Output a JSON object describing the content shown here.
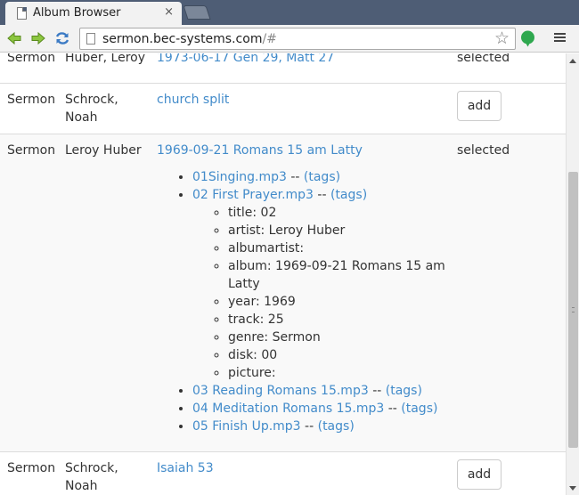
{
  "browser": {
    "tab_title": "Album Browser",
    "close_glyph": "×",
    "url_host": "sermon.bec-systems.com",
    "url_path": "/#",
    "star_glyph": "☆"
  },
  "rows": [
    {
      "type": "Sermon",
      "artist": "Huber, Leroy",
      "album": "1973-06-17 Gen 29, Matt 27",
      "status": "selected"
    },
    {
      "type": "Sermon",
      "artist": "Schrock, Noah",
      "album": "church split",
      "action": "add"
    },
    {
      "type": "Sermon",
      "artist": "Leroy Huber",
      "album": "1969-09-21 Romans 15 am Latty",
      "status": "selected",
      "tracks": [
        {
          "name": "01Singing.mp3",
          "sep": " -- ",
          "tags_link": "(tags)"
        },
        {
          "name": "02 First Prayer.mp3",
          "sep": " -- ",
          "tags_link": "(tags)",
          "tags": [
            "title: 02",
            "artist: Leroy Huber",
            "albumartist:",
            "album: 1969-09-21 Romans 15 am Latty",
            "year: 1969",
            "track: 25",
            "genre: Sermon",
            "disk: 00",
            "picture:"
          ]
        },
        {
          "name": "03 Reading Romans 15.mp3",
          "sep": " -- ",
          "tags_link": "(tags)"
        },
        {
          "name": "04 Meditation Romans 15.mp3",
          "sep": " -- ",
          "tags_link": "(tags)"
        },
        {
          "name": "05 Finish Up.mp3",
          "sep": " -- ",
          "tags_link": "(tags)"
        }
      ]
    },
    {
      "type": "Sermon",
      "artist": "Schrock, Noah",
      "album": "Isaiah 53",
      "action": "add"
    }
  ]
}
